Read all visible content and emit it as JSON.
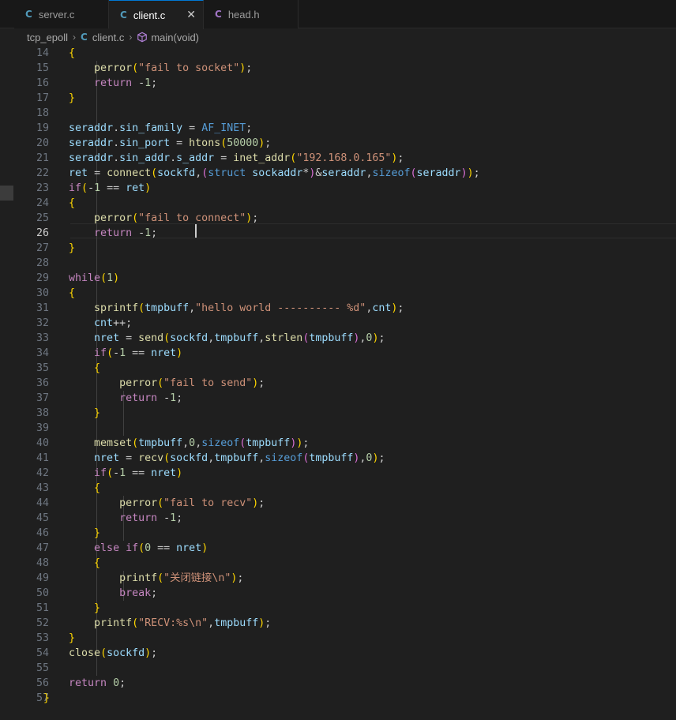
{
  "tabs": [
    {
      "icon": "C",
      "label": "server.c",
      "active": false
    },
    {
      "icon": "C",
      "label": "client.c",
      "active": true,
      "close": "✕"
    },
    {
      "icon": "C",
      "label": "head.h",
      "active": false
    }
  ],
  "breadcrumb": {
    "folder": "tcp_epoll",
    "file_icon": "C",
    "file": "client.c",
    "symbol": "main(void)"
  },
  "colors": {
    "accent": "#0078d4",
    "c_icon": "#519aba",
    "h_icon": "#a074c4",
    "keyword": "#c586c0",
    "string": "#ce9178",
    "function": "#dcdcaa",
    "variable": "#9cdcfe"
  },
  "editor": {
    "current_line": 26,
    "lines": [
      {
        "n": "14",
        "text": "    {"
      },
      {
        "n": "15",
        "text": "        perror(\"fail to socket\");"
      },
      {
        "n": "16",
        "text": "        return -1;"
      },
      {
        "n": "17",
        "text": "    }"
      },
      {
        "n": "18",
        "text": ""
      },
      {
        "n": "19",
        "text": "    seraddr.sin_family = AF_INET;"
      },
      {
        "n": "20",
        "text": "    seraddr.sin_port = htons(50000);"
      },
      {
        "n": "21",
        "text": "    seraddr.sin_addr.s_addr = inet_addr(\"192.168.0.165\");"
      },
      {
        "n": "22",
        "text": "    ret = connect(sockfd,(struct sockaddr*)&seraddr,sizeof(seraddr));"
      },
      {
        "n": "23",
        "text": "    if(-1 == ret)"
      },
      {
        "n": "24",
        "text": "    {"
      },
      {
        "n": "25",
        "text": "        perror(\"fail to connect\");"
      },
      {
        "n": "26",
        "text": "        return -1; "
      },
      {
        "n": "27",
        "text": "    }"
      },
      {
        "n": "28",
        "text": ""
      },
      {
        "n": "29",
        "text": "    while(1)"
      },
      {
        "n": "30",
        "text": "    {"
      },
      {
        "n": "31",
        "text": "        sprintf(tmpbuff,\"hello world ---------- %d\",cnt);"
      },
      {
        "n": "32",
        "text": "        cnt++;"
      },
      {
        "n": "33",
        "text": "        nret = send(sockfd,tmpbuff,strlen(tmpbuff),0);"
      },
      {
        "n": "34",
        "text": "        if(-1 == nret)"
      },
      {
        "n": "35",
        "text": "        {"
      },
      {
        "n": "36",
        "text": "            perror(\"fail to send\");"
      },
      {
        "n": "37",
        "text": "            return -1;"
      },
      {
        "n": "38",
        "text": "        }"
      },
      {
        "n": "39",
        "text": ""
      },
      {
        "n": "40",
        "text": "        memset(tmpbuff,0,sizeof(tmpbuff));"
      },
      {
        "n": "41",
        "text": "        nret = recv(sockfd,tmpbuff,sizeof(tmpbuff),0);"
      },
      {
        "n": "42",
        "text": "        if(-1 == nret)"
      },
      {
        "n": "43",
        "text": "        {"
      },
      {
        "n": "44",
        "text": "            perror(\"fail to recv\");"
      },
      {
        "n": "45",
        "text": "            return -1;"
      },
      {
        "n": "46",
        "text": "        }"
      },
      {
        "n": "47",
        "text": "        else if(0 == nret)"
      },
      {
        "n": "48",
        "text": "        {"
      },
      {
        "n": "49",
        "text": "            printf(\"关闭链接\\n\");"
      },
      {
        "n": "50",
        "text": "            break;"
      },
      {
        "n": "51",
        "text": "        }"
      },
      {
        "n": "52",
        "text": "        printf(\"RECV:%s\\n\",tmpbuff);"
      },
      {
        "n": "53",
        "text": "    }"
      },
      {
        "n": "54",
        "text": "    close(sockfd);"
      },
      {
        "n": "55",
        "text": ""
      },
      {
        "n": "56",
        "text": "    return 0;"
      },
      {
        "n": "57",
        "text": "}"
      }
    ]
  }
}
